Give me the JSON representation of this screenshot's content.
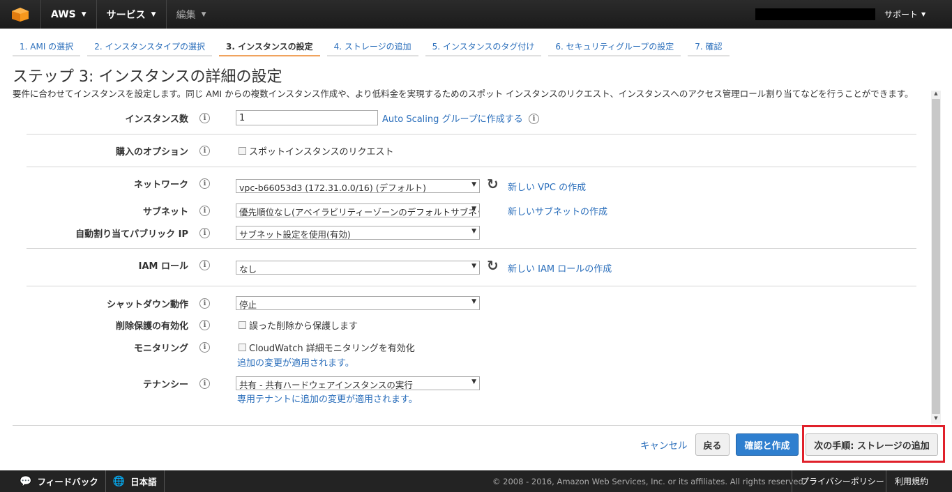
{
  "header": {
    "brand": "AWS",
    "services": "サービス",
    "edit": "編集",
    "support": "サポート"
  },
  "steps": [
    {
      "label": "1. AMI の選択",
      "active": false
    },
    {
      "label": "2. インスタンスタイプの選択",
      "active": false
    },
    {
      "label": "3. インスタンスの設定",
      "active": true
    },
    {
      "label": "4. ストレージの追加",
      "active": false
    },
    {
      "label": "5. インスタンスのタグ付け",
      "active": false
    },
    {
      "label": "6. セキュリティグループの設定",
      "active": false
    },
    {
      "label": "7. 確認",
      "active": false
    }
  ],
  "page": {
    "title": "ステップ 3: インスタンスの詳細の設定",
    "description": "要件に合わせてインスタンスを設定します。同じ AMI からの複数インスタンス作成や、より低料金を実現するためのスポット インスタンスのリクエスト、インスタンスへのアクセス管理ロール割り当てなどを行うことができます。"
  },
  "form": {
    "instance_count": {
      "label": "インスタンス数",
      "value": "1",
      "link": "Auto Scaling グループに作成する"
    },
    "purchase_option": {
      "label": "購入のオプション",
      "checkbox": "スポットインスタンスのリクエスト"
    },
    "network": {
      "label": "ネットワーク",
      "value": "vpc-b66053d3 (172.31.0.0/16) (デフォルト)",
      "link": "新しい VPC の作成"
    },
    "subnet": {
      "label": "サブネット",
      "value": "優先順位なし(アベイラビリティーゾーンのデフォルトサブネット)",
      "link": "新しいサブネットの作成"
    },
    "public_ip": {
      "label": "自動割り当てパブリック IP",
      "value": "サブネット設定を使用(有効)"
    },
    "iam_role": {
      "label": "IAM ロール",
      "value": "なし",
      "link": "新しい IAM ロールの作成"
    },
    "shutdown": {
      "label": "シャットダウン動作",
      "value": "停止"
    },
    "termination_protection": {
      "label": "削除保護の有効化",
      "checkbox": "誤った削除から保護します"
    },
    "monitoring": {
      "label": "モニタリング",
      "checkbox": "CloudWatch 詳細モニタリングを有効化",
      "note": "追加の変更が適用されます。"
    },
    "tenancy": {
      "label": "テナンシー",
      "value": "共有 - 共有ハードウェアインスタンスの実行",
      "note": "専用テナントに追加の変更が適用されます。"
    }
  },
  "actions": {
    "cancel": "キャンセル",
    "back": "戻る",
    "review": "確認と作成",
    "next": "次の手順: ストレージの追加"
  },
  "footer": {
    "feedback": "フィードバック",
    "language": "日本語",
    "copyright": "© 2008 - 2016, Amazon Web Services, Inc. or its affiliates. All rights reserved.",
    "privacy": "プライバシーポリシー",
    "terms": "利用規約"
  },
  "icons": {
    "logo": "aws-cube-icon",
    "info": "info-icon",
    "refresh": "refresh-icon",
    "feedback": "speech-bubble-icon",
    "globe": "globe-icon"
  },
  "colors": {
    "link": "#2a6ebb",
    "primary_button": "#2f7fcf",
    "active_step_underline": "#f0a35e",
    "highlight_frame": "#e0202a"
  }
}
